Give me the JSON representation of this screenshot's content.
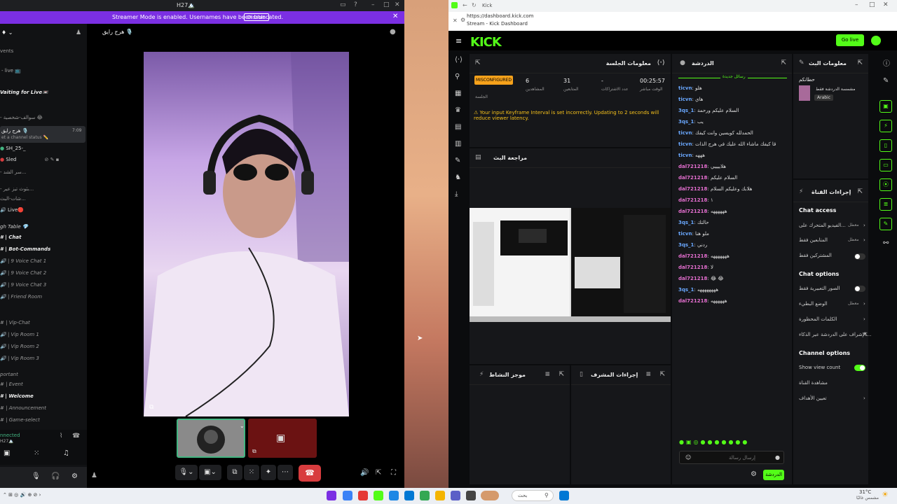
{
  "discord": {
    "title": "H27🏔️",
    "streamer_mode": {
      "message": "Streamer Mode is enabled. Usernames have been truncated.",
      "disable_label": "Disable"
    },
    "header_name": "هرج رايق 🎙️",
    "sidebar": {
      "events": "vents",
      "waiting": "Vaiting for Live📼",
      "voice_entry": "هرج رايق 🎙️",
      "voice_entry_sub": "et a channel status ✏️",
      "voice_time": "7:09",
      "user1": "SH_25-_",
      "user2": "Sled",
      "live": "Live🔴",
      "high_table": "gh Table 💎",
      "channels": [
        "Chat",
        "Bot-Commands",
        "9 Voice Chat 1",
        "9 Voice Chat 2",
        "9 Voice Chat 3",
        "Friend Room",
        "Vip-Chat",
        "Vip Room 1",
        "Vip Room 2",
        "Vip Room 3"
      ],
      "important": "portant",
      "info_channels": [
        "Event",
        "Welcome",
        "Announcement",
        "Game-select"
      ],
      "connected": "nnected",
      "connected_sub": "H27🏔️"
    }
  },
  "browser": {
    "tab_title": "Kick",
    "url": "https://dashboard.kick.com",
    "page_subtitle": "Stream - Kick Dashboard"
  },
  "kick": {
    "logo": "KICK",
    "go_live": "Go live",
    "session": {
      "title": "معلومات الجلسة",
      "status": "MISCONFIGURED",
      "status_label": "الجلسة",
      "viewers": "6",
      "viewers_label": "المشاهدين",
      "followers": "31",
      "followers_label": "المتابعين",
      "subs": "-",
      "subs_label": "عدد الاشتراكات",
      "time": "00:25:57",
      "time_label": "الوقت مباشر",
      "warning": "Your input Keyframe Interval is set incorrectly. Updating to 2 seconds will reduce viewer latency."
    },
    "preview_title": "مراجعة البث",
    "chat": {
      "title": "الدردشة",
      "banner": "رسائل جديدة",
      "messages": [
        {
          "user": "ticvn",
          "text": "هلو"
        },
        {
          "user": "ticvn",
          "text": "هاي"
        },
        {
          "user": "3qs_1",
          "text": "السلام عليكم ورحمة"
        },
        {
          "user": "3qs_1",
          "text": "يب"
        },
        {
          "user": "ticvn",
          "text": "الحمدلله كويسين وانت كيفك"
        },
        {
          "user": "ticvn",
          "text": "قا كيفك ماشاء الله عليك في هرج الذات"
        },
        {
          "user": "ticvn",
          "text": "هههه"
        },
        {
          "user": "dal721218",
          "text": "هلاييييي"
        },
        {
          "user": "dal721218",
          "text": "السلام عليكم"
        },
        {
          "user": "dal721218",
          "text": "هلابك وعليكم السلام"
        },
        {
          "user": "dal721218",
          "text": "١"
        },
        {
          "user": "dal721218",
          "text": "ههههههه"
        },
        {
          "user": "3qs_1",
          "text": "حالتك"
        },
        {
          "user": "ticvn",
          "text": "ملو هنا"
        },
        {
          "user": "3qs_1",
          "text": "ردني"
        },
        {
          "user": "dal721218",
          "text": "هههههههه"
        },
        {
          "user": "dal721218",
          "text": "لا"
        },
        {
          "user": "dal721218",
          "text": "😂 😂"
        },
        {
          "user": "3qs_1",
          "text": "ههههههههه"
        },
        {
          "user": "dal721218",
          "text": "ههههههه"
        }
      ],
      "input_placeholder": "إرسال رسالة",
      "send_label": "الدردشة"
    },
    "stream_info": {
      "title": "معلومات البث",
      "stream_title": "حطانكم",
      "category": "مشمسة الدردشة فقط",
      "language": "Arabic"
    },
    "channel_actions": {
      "title": "إجراءات القناة",
      "chat_access": "Chat access",
      "chat_access_items": [
        {
          "label": "الفيديو المتحرك على...",
          "value": "معطل"
        },
        {
          "label": "المتابعين فقط",
          "value": "معطل"
        },
        {
          "label": "المشتركين فقط",
          "value": ""
        }
      ],
      "chat_options": "Chat options",
      "chat_options_items": [
        {
          "label": "الصور التعبيرية فقط"
        },
        {
          "label": "الوضع البطيء",
          "value": "معطل"
        },
        {
          "label": "الكلمات المحظورة"
        },
        {
          "label": "الإشراف على الدردشة عبر الذكاء..."
        }
      ],
      "channel_options": "Channel options",
      "channel_options_items": [
        {
          "label": "Show view count"
        },
        {
          "label": "مشاهدة القناة"
        },
        {
          "label": "تعيين الأهداف"
        }
      ]
    },
    "activity_title": "موجز النشاط",
    "mod_title": "إجراءات المشرف"
  },
  "taskbar": {
    "weather": "31°C",
    "weather_sub": "مشمس غالبًا",
    "search": "بحث"
  }
}
